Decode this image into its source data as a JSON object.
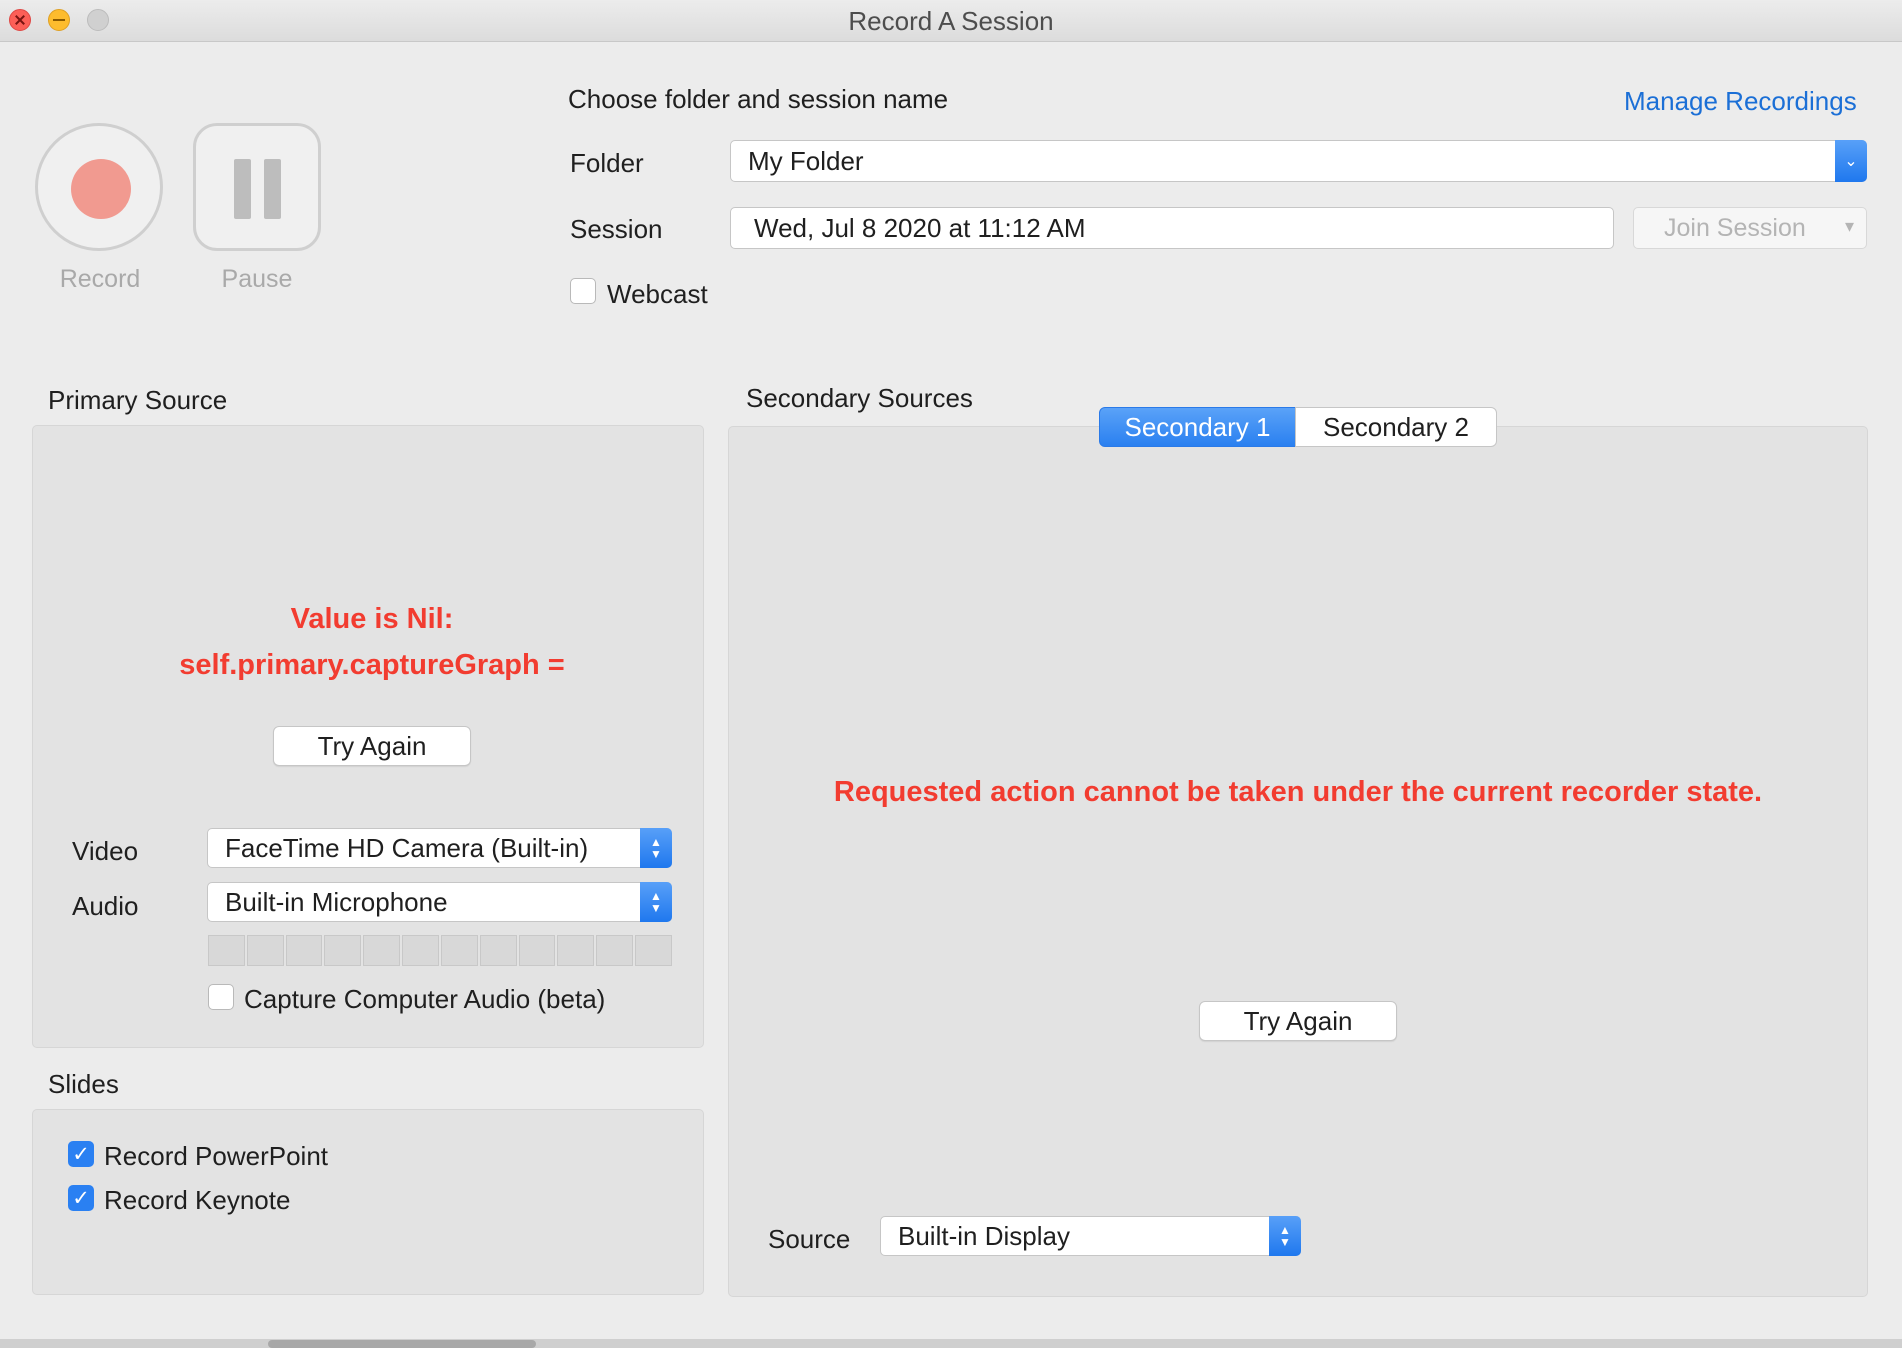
{
  "window": {
    "title": "Record A Session"
  },
  "controls": {
    "record_label": "Record",
    "pause_label": "Pause"
  },
  "session": {
    "heading": "Choose folder and session name",
    "manage_link": "Manage Recordings",
    "folder_label": "Folder",
    "folder_value": "My Folder",
    "session_label": "Session",
    "session_value": "Wed, Jul 8 2020 at 11:12 AM",
    "join_label": "Join Session",
    "webcast_label": "Webcast",
    "webcast_checked": false
  },
  "primary": {
    "title": "Primary Source",
    "error_line1": "Value is Nil:",
    "error_line2": "self.primary.captureGraph =",
    "try_again": "Try Again",
    "video_label": "Video",
    "video_value": "FaceTime HD Camera (Built-in)",
    "audio_label": "Audio",
    "audio_value": "Built-in Microphone",
    "audio_level": 0,
    "capture_audio_label": "Capture Computer Audio (beta)",
    "capture_audio_checked": false
  },
  "slides": {
    "title": "Slides",
    "record_powerpoint": "Record PowerPoint",
    "record_powerpoint_checked": true,
    "record_keynote": "Record Keynote",
    "record_keynote_checked": true
  },
  "secondary": {
    "title": "Secondary Sources",
    "tabs": [
      "Secondary 1",
      "Secondary 2"
    ],
    "selected_tab": "Secondary 1",
    "error": "Requested action cannot be taken under the current recorder state.",
    "try_again": "Try Again",
    "source_label": "Source",
    "source_value": "Built-in Display"
  },
  "colors": {
    "accent": "#2a80f2",
    "error": "#f23c30",
    "link": "#1b6fd6",
    "record_dot": "#f19a90"
  }
}
